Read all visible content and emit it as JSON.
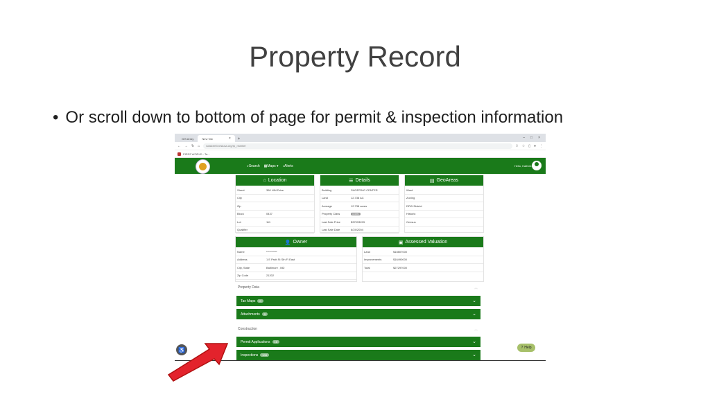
{
  "slide": {
    "title": "Property Record",
    "bullet_dot": "•",
    "bullet": "Or scroll down to bottom of page for permit & inspection information"
  },
  "browser": {
    "tab1": "GIS Array",
    "tab2": "New Tab",
    "url": "sdatcert3.resiusa.org/rp_rewrite/",
    "bookmark": "FIREZ WORLD - Ta..."
  },
  "app": {
    "nav_search": "Search",
    "nav_maps": "Maps",
    "nav_alerts": "Alerts",
    "greeting": "Hello, Kathleen"
  },
  "location": {
    "title": "Location",
    "rows": [
      {
        "k": "Street",
        "v": "350 HIN Drive"
      },
      {
        "k": "City",
        "v": ""
      },
      {
        "k": "Zip",
        "v": ""
      },
      {
        "k": "Block",
        "v": "0437"
      },
      {
        "k": "Lot",
        "v": "111"
      },
      {
        "k": "Qualifier",
        "v": ""
      }
    ]
  },
  "details": {
    "title": "Details",
    "rows": [
      {
        "k": "Building",
        "v": "SHOPPING CENTER"
      },
      {
        "k": "Land",
        "v": "12.738 AC"
      },
      {
        "k": "Acreage",
        "v": "12.738 acres"
      },
      {
        "k": "Property Class",
        "v": "",
        "pill": "COMM"
      },
      {
        "k": "Last Sale Price",
        "v": "$37093203"
      },
      {
        "k": "Last Sale Date",
        "v": "6/24/2004"
      }
    ]
  },
  "geo": {
    "title": "GeoAreas",
    "rows": [
      {
        "k": "Ward",
        "v": ""
      },
      {
        "k": "Zoning",
        "v": ""
      },
      {
        "k": "DPW District",
        "v": ""
      },
      {
        "k": "Historic",
        "v": ""
      },
      {
        "k": "Census",
        "v": ""
      }
    ]
  },
  "owner": {
    "title": "Owner",
    "rows": [
      {
        "k": "Name",
        "v": "**********"
      },
      {
        "k": "Address",
        "v": "1 E Pratt St Sth Fl East"
      },
      {
        "k": "City, State",
        "v": "Baltimore , MD"
      },
      {
        "k": "Zip Code",
        "v": "21202"
      }
    ]
  },
  "valuation": {
    "title": "Assessed Valuation",
    "rows": [
      {
        "k": "Land",
        "v": "$10807000"
      },
      {
        "k": "Improvements",
        "v": "$16490000"
      },
      {
        "k": "Total",
        "v": "$27297000"
      }
    ]
  },
  "sections": {
    "property_data": "Property Data",
    "construction": "Construction",
    "tax_maps": "Tax Maps",
    "tax_maps_count": "0",
    "attachments": "Attachments",
    "attachments_count": "0",
    "permit_apps": "Permit Applications",
    "permit_apps_count": "16",
    "inspections": "Inspections",
    "inspections_count": "108"
  },
  "help_label": "Help",
  "colors": {
    "accent": "#1a7a1a",
    "arrow": "#e3232c"
  }
}
